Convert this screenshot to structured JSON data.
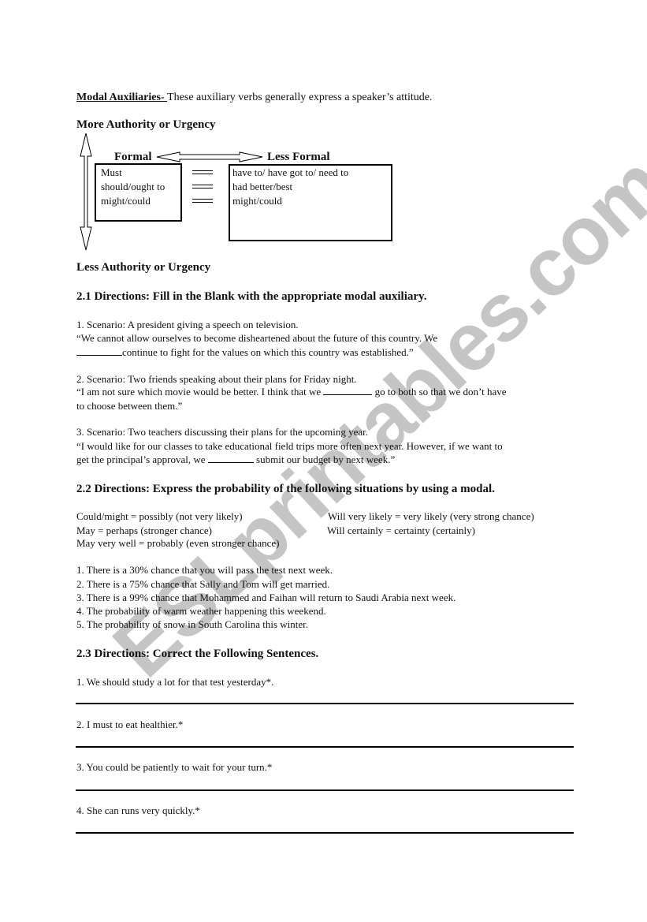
{
  "watermark": "ESLprintables.com",
  "intro": {
    "title": "Modal Auxiliaries- ",
    "description": "These auxiliary verbs generally express a speaker’s attitude."
  },
  "diagram": {
    "top_label": "More Authority or Urgency",
    "bottom_label": "Less Authority or Urgency",
    "formal_label": "Formal",
    "less_formal_label": "Less Formal",
    "formal_items": [
      "Must",
      "should/ought to",
      "might/could"
    ],
    "less_formal_items": [
      "have to/ have got to/ need to",
      "had better/best",
      "might/could"
    ],
    "equals_sign": "equals"
  },
  "section_2_1": {
    "heading": "2.1  Directions:  Fill in the Blank with the appropriate modal auxiliary.",
    "items": [
      {
        "scenario": "1.  Scenario: A president giving a speech on television.",
        "line1": "“We cannot allow ourselves to become disheartened about the future of this country.  We",
        "line2_after_blank": "continue to fight for the values on which this country was established.”"
      },
      {
        "scenario": "2.  Scenario:  Two friends speaking about their plans for Friday night.",
        "line1_before_blank": "“I am not sure which movie would be better.  I think that we ",
        "line1_after_blank": " go to both so that we don’t have",
        "line2": "to choose between them.”"
      },
      {
        "scenario": "3.  Scenario:  Two teachers discussing their plans for the upcoming year.",
        "line1": "“I would like for our classes to take educational field trips more often next year.  However, if we want to",
        "line2_before_blank": "get the principal’s approval, we ",
        "line2_after_blank": " submit our budget by next week.”"
      }
    ]
  },
  "section_2_2": {
    "heading": "2.2   Directions:  Express the probability of the following situations by using a modal.",
    "key_left": [
      "Could/might = possibly (not very likely)",
      "May = perhaps (stronger chance)",
      "May very well = probably (even stronger chance)"
    ],
    "key_right": [
      "Will very likely = very likely (very strong chance)",
      "Will certainly = certainty (certainly)"
    ],
    "items": [
      "1.  There is a 30% chance that you will pass the test next week.",
      "2.  There is a 75% chance that Sally and Tom will get married.",
      "3.  There is a 99% chance that Mohammed and Faihan will return to Saudi Arabia next week.",
      "4.  The probability of warm weather happening this weekend.",
      "5.  The probability of snow in South Carolina this winter."
    ]
  },
  "section_2_3": {
    "heading": "2.3  Directions:  Correct the Following Sentences.",
    "items": [
      "1.  We should study a lot for that test yesterday*.",
      "2.  I must to eat healthier.*",
      "3.  You could be patiently to wait for your turn.*",
      "4.  She can runs very quickly.*"
    ]
  }
}
